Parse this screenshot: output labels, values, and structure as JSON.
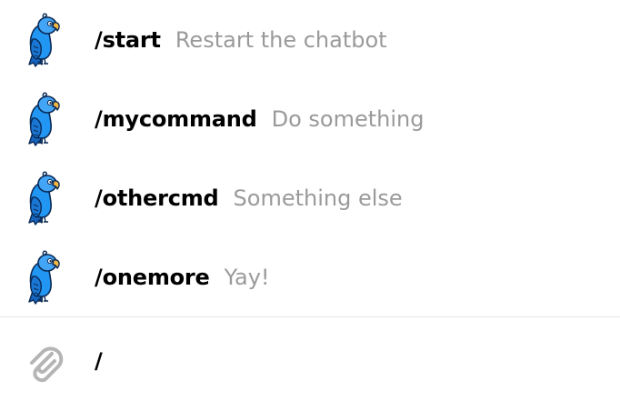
{
  "commands": [
    {
      "name": "/start",
      "description": "Restart the chatbot",
      "avatar_icon": "blue-parrot-icon"
    },
    {
      "name": "/mycommand",
      "description": "Do something",
      "avatar_icon": "blue-parrot-icon"
    },
    {
      "name": "/othercmd",
      "description": "Something else",
      "avatar_icon": "blue-parrot-icon"
    },
    {
      "name": "/onemore",
      "description": "Yay!",
      "avatar_icon": "blue-parrot-icon"
    }
  ],
  "composer": {
    "attach_icon": "paperclip-icon",
    "input_value": "/"
  },
  "colors": {
    "command_name": "#000000",
    "command_description": "#9a9a9a",
    "divider": "#e3e3e3",
    "attach_icon": "#b5b5b5",
    "parrot_body": "#1e88e5",
    "parrot_beak": "#f5b942"
  }
}
